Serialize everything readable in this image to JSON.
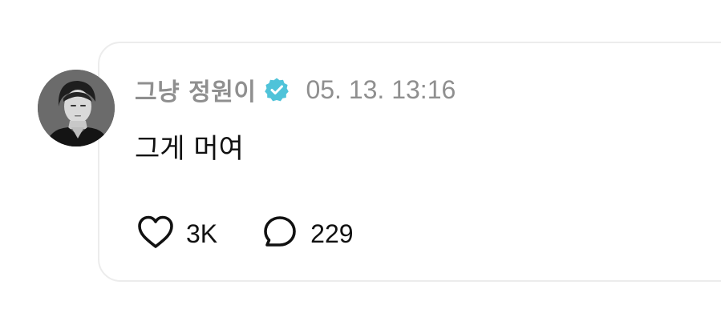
{
  "post": {
    "username": "그냥 정원이",
    "timestamp": "05. 13. 13:16",
    "content": "그게 머여",
    "likes": "3K",
    "comments": "229"
  },
  "icons": {
    "verified": "verified-badge-icon",
    "like": "heart-icon",
    "comment": "speech-bubble-icon"
  },
  "colors": {
    "verified": "#4fc3d9",
    "meta_text": "#8f8f8f",
    "body_text": "#111111",
    "card_border": "#ececec"
  }
}
